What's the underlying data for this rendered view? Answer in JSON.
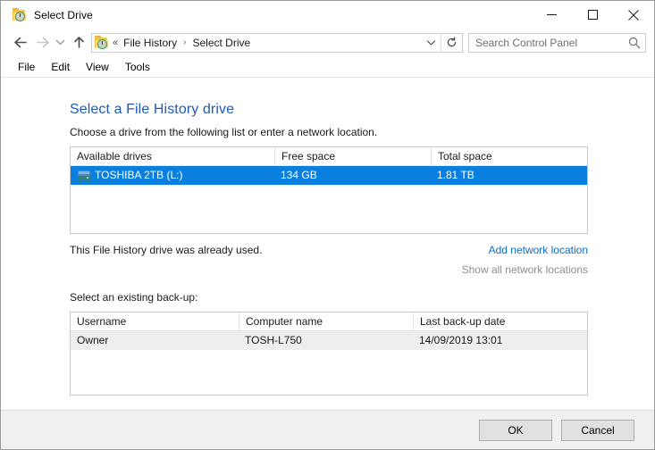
{
  "window": {
    "title": "Select Drive",
    "icon": "file-history-icon",
    "controls": {
      "minimize": "minimize-icon",
      "maximize": "maximize-icon",
      "close": "close-icon"
    }
  },
  "navbar": {
    "back": "back-arrow-icon",
    "forward": "forward-arrow-icon",
    "recent": "recent-locations-icon",
    "up": "up-arrow-icon",
    "address_icon": "file-history-icon",
    "chevrons": "«",
    "breadcrumbs": [
      {
        "label": "File History"
      },
      {
        "label": "Select Drive"
      }
    ],
    "separator": "›",
    "dropdown": "chevron-down-icon",
    "refresh": "refresh-icon"
  },
  "search": {
    "placeholder": "Search Control Panel",
    "value": "",
    "icon": "search-icon"
  },
  "menubar": {
    "items": [
      {
        "label": "File"
      },
      {
        "label": "Edit"
      },
      {
        "label": "View"
      },
      {
        "label": "Tools"
      }
    ]
  },
  "main": {
    "heading": "Select a File History drive",
    "subtitle": "Choose a drive from the following list or enter a network location.",
    "drives_list": {
      "columns": [
        "Available drives",
        "Free space",
        "Total space"
      ],
      "rows": [
        {
          "icon": "hard-drive-icon",
          "name": "TOSHIBA 2TB (L:)",
          "free_space": "134 GB",
          "total_space": "1.81 TB",
          "selected": true
        }
      ]
    },
    "status_text": "This File History drive was already used.",
    "links": [
      {
        "label": "Add network location",
        "disabled": false
      },
      {
        "label": "Show all network locations",
        "disabled": true
      }
    ],
    "backup_label": "Select an existing back-up:",
    "backups_list": {
      "columns": [
        "Username",
        "Computer name",
        "Last back-up date"
      ],
      "rows": [
        {
          "username": "Owner",
          "computer_name": "TOSH-L750",
          "last_backup_date": "14/09/2019 13:01"
        }
      ]
    }
  },
  "footer": {
    "ok_label": "OK",
    "cancel_label": "Cancel"
  },
  "colors": {
    "selection_blue": "#0a7fe0",
    "heading_blue": "#1f5bb5",
    "link_blue": "#0a6cc4",
    "link_disabled": "#8e8e8e",
    "footer_bg": "#f0f0f0",
    "row_alt_bg": "#eeeeee"
  }
}
